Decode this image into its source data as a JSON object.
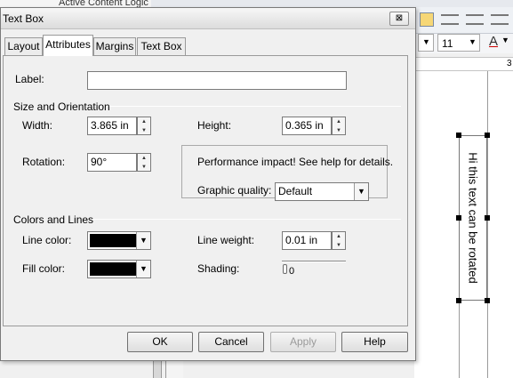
{
  "background": {
    "doc_tab_label": "Active Content Logic",
    "font_size_value": "11",
    "ruler_mark": "3",
    "textbox_content": "Hi this text can be rotated"
  },
  "dialog": {
    "title": "Text Box",
    "close_glyph": "⊠",
    "tabs": [
      "Layout",
      "Attributes",
      "Margins",
      "Text Box"
    ],
    "active_tab": "Attributes",
    "label_field": {
      "label": "Label:",
      "value": ""
    },
    "size_section": {
      "title": "Size and Orientation",
      "width_label": "Width:",
      "width_value": "3.865 in",
      "height_label": "Height:",
      "height_value": "0.365 in",
      "rotation_label": "Rotation:",
      "rotation_value": "90°",
      "perf_note": "Performance impact! See help for details.",
      "graphic_quality_label": "Graphic quality:",
      "graphic_quality_value": "Default"
    },
    "colors_section": {
      "title": "Colors and Lines",
      "line_color_label": "Line color:",
      "line_color": "#000000",
      "fill_color_label": "Fill color:",
      "fill_color": "#000000",
      "line_weight_label": "Line weight:",
      "line_weight_value": "0.01 in",
      "shading_label": "Shading:",
      "shading_value": "0"
    },
    "buttons": {
      "ok": "OK",
      "cancel": "Cancel",
      "apply": "Apply",
      "help": "Help"
    }
  }
}
